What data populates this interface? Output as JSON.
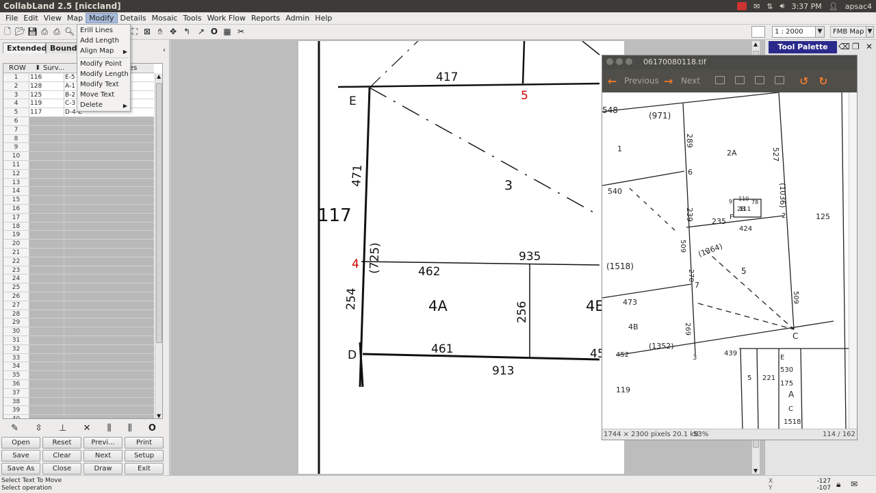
{
  "window": {
    "title": "CollabLand 2.5 [niccland]"
  },
  "tray": {
    "time": "3:37 PM",
    "user": "apsac4"
  },
  "menubar": [
    "File",
    "Edit",
    "View",
    "Map",
    "Modify",
    "Details",
    "Mosaic",
    "Tools",
    "Work Flow",
    "Reports",
    "Admin",
    "Help"
  ],
  "toolbar": {
    "scale": "1 : 2000",
    "map_type": "FMB Map"
  },
  "modify_menu": {
    "items": [
      "Erill Lines",
      "Add Length",
      "Align Map",
      "Modify Point",
      "Modify Length",
      "Modify Text",
      "Move Text",
      "Delete"
    ]
  },
  "left_panel": {
    "tabs": [
      "Extended",
      "Bounda",
      "L"
    ],
    "columns": [
      "ROW",
      "Surv...",
      "es"
    ],
    "rows": [
      {
        "n": "1",
        "surv": "116",
        "val": "E-5"
      },
      {
        "n": "2",
        "surv": "128",
        "val": "A-1"
      },
      {
        "n": "3",
        "surv": "125",
        "val": "B-2"
      },
      {
        "n": "4",
        "surv": "119",
        "val": "C-3"
      },
      {
        "n": "5",
        "surv": "117",
        "val": "D-4-E"
      }
    ],
    "empty_rows": [
      "6",
      "7",
      "8",
      "9",
      "10",
      "11",
      "12",
      "13",
      "14",
      "15",
      "16",
      "17",
      "18",
      "19",
      "20",
      "21",
      "22",
      "23",
      "24",
      "25",
      "26",
      "27",
      "28",
      "29",
      "30",
      "31",
      "32",
      "33",
      "34",
      "35",
      "36",
      "37",
      "38",
      "39",
      "40"
    ],
    "buttons": [
      "Open",
      "Reset",
      "Previ...",
      "Print",
      "Save",
      "Clear",
      "Next",
      "Setup",
      "Save As",
      "Close",
      "Draw",
      "Exit"
    ]
  },
  "drawing": {
    "labels": {
      "e": "E",
      "d": "D",
      "n417": "417",
      "n5": "5",
      "n471": "471",
      "n3": "3",
      "n117": "117",
      "n725": "(725)",
      "n4": "4",
      "n935": "935",
      "n462": "462",
      "n4A": "4A",
      "n256": "256",
      "n4B": "4E",
      "n254": "254",
      "n461": "461",
      "n913": "913",
      "n45": "45"
    }
  },
  "palette": {
    "title": "Tool Palette"
  },
  "viewer": {
    "filename": "06170080118.tif",
    "prev": "Previous",
    "next": "Next",
    "info": "1744 × 2300 pixels  20.1 kB",
    "zoom": "53%",
    "page": "114 / 162",
    "scan_labels": [
      "548",
      "(971)",
      "1",
      "289",
      "2A",
      "527",
      "6",
      "540",
      "239",
      "9",
      "110",
      "2B",
      "78",
      "F",
      "235",
      "111",
      "424",
      "(1036)",
      "2",
      "125",
      "509",
      "(1518)",
      "270",
      "(1364)",
      "5",
      "7",
      "473",
      "4B",
      "269",
      "509",
      "C",
      "452",
      "(1352)",
      "3",
      "439",
      "E",
      "530",
      "175",
      "5",
      "221",
      "A",
      "C",
      "1518",
      "119"
    ]
  },
  "status": {
    "line1": "Select Text To Move",
    "line2": "Select operation",
    "x_label": "X",
    "y_label": "Y",
    "x": "-127",
    "y": "-107"
  }
}
